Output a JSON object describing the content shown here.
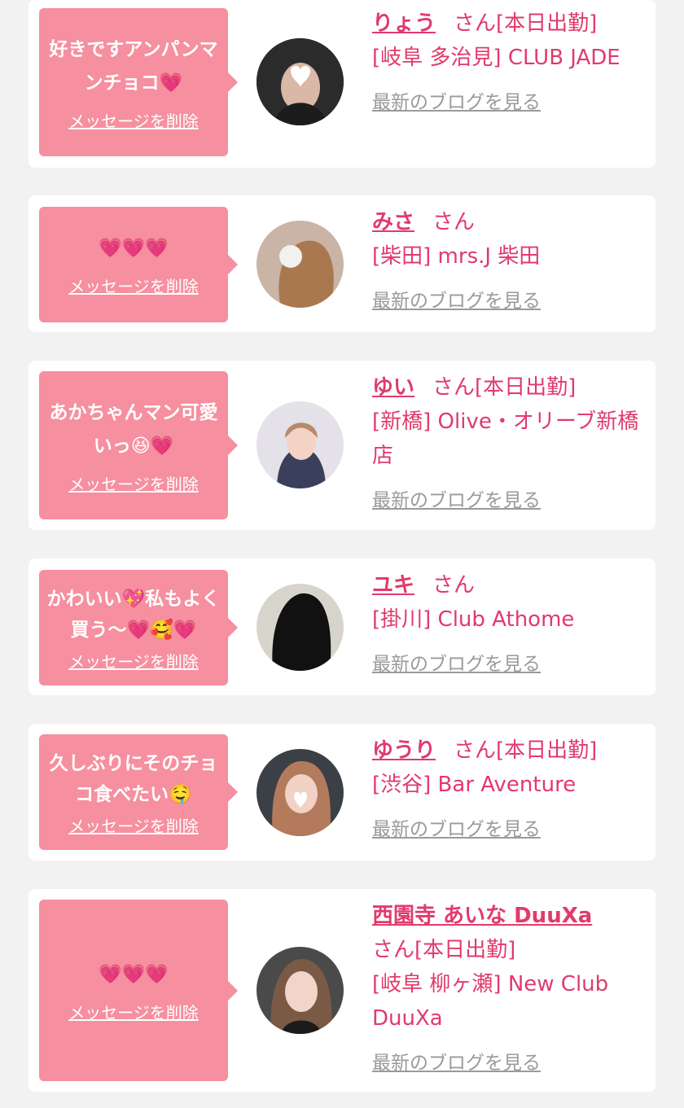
{
  "cards": [
    {
      "message": "好きですアンパンマンチョコ💗",
      "delete_label": "メッセージを削除",
      "name": "りょう",
      "san": "さん[本日出勤]",
      "shop": "[岐阜 多治見] CLUB JADE",
      "blog_label": "最新のブログを見る"
    },
    {
      "message": "💗💗💗",
      "delete_label": "メッセージを削除",
      "name": "みさ",
      "san": "さん",
      "shop": "[柴田] mrs.J 柴田",
      "blog_label": "最新のブログを見る"
    },
    {
      "message": "あかちゃんマン可愛いっ😆💗",
      "delete_label": "メッセージを削除",
      "name": "ゆい",
      "san": "さん[本日出勤]",
      "shop": "[新橋] Olive・オリーブ新橋店",
      "blog_label": "最新のブログを見る"
    },
    {
      "message": "かわいい💖私もよく買う〜💗🥰💗",
      "delete_label": "メッセージを削除",
      "name": "ユキ",
      "san": "さん",
      "shop": "[掛川] Club Athome",
      "blog_label": "最新のブログを見る"
    },
    {
      "message": "久しぶりにそのチョコ食べたい🤤",
      "delete_label": "メッセージを削除",
      "name": "ゆうり",
      "san": "さん[本日出勤]",
      "shop": "[渋谷] Bar Aventure",
      "blog_label": "最新のブログを見る"
    },
    {
      "message": "💗💗💗",
      "delete_label": "メッセージを削除",
      "name": "西園寺 あいな DuuXa",
      "san": "さん[本日出勤]",
      "shop": "[岐阜 柳ヶ瀬] New Club DuuXa",
      "blog_label": "最新のブログを見る"
    }
  ],
  "colors": {
    "bubble": "#f68f9f",
    "accent": "#e13a6d",
    "muted": "#9a9a9a",
    "background": "#f2f2f2"
  }
}
